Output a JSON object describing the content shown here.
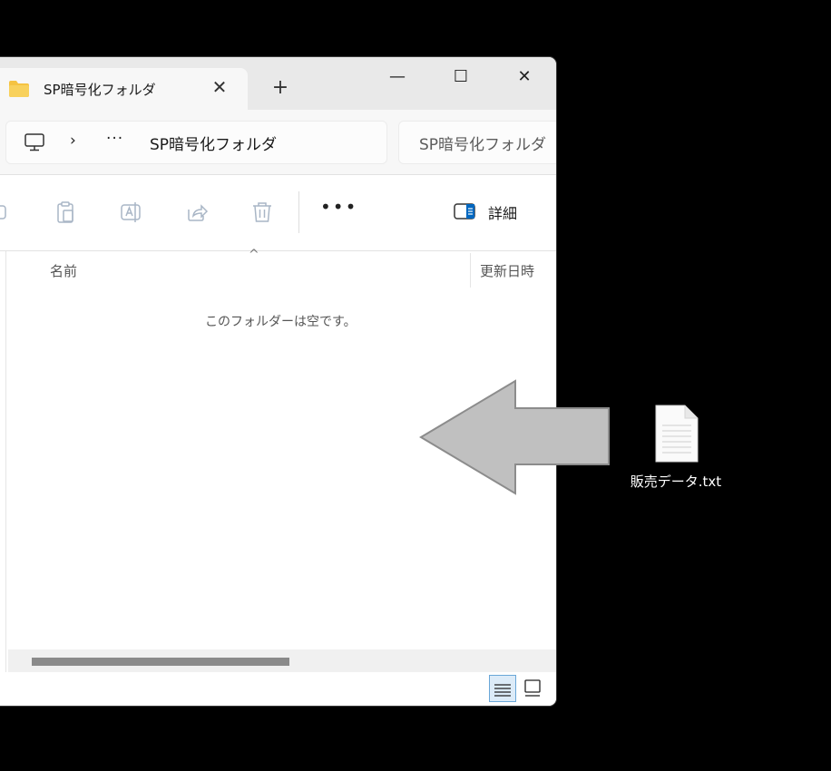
{
  "window": {
    "tab": {
      "label": "SP暗号化フォルダ"
    },
    "buttons": {
      "new_tab": "+",
      "minimize": "—",
      "maximize": "☐",
      "close": "✕",
      "tab_close": "✕"
    },
    "address": {
      "chevron": "›",
      "overflow": "···",
      "crumb": "SP暗号化フォルダ"
    },
    "search": {
      "placeholder": "SP暗号化フォルダ"
    },
    "commands": {
      "icons": [
        "copy-icon",
        "paste-icon",
        "rename-icon",
        "share-icon",
        "delete-icon"
      ],
      "more": "•••",
      "details_label": "詳細"
    },
    "columns": {
      "sort_indicator": "^",
      "name": "名前",
      "date": "更新日時"
    },
    "empty_message": "このフォルダーは空です。",
    "view_modes": {
      "active": "details"
    }
  },
  "desktop": {
    "file": {
      "name": "販売データ.txt"
    },
    "overlay": {
      "direction": "left"
    }
  },
  "colors": {
    "background": "#000000",
    "window_bg": "#ffffff",
    "titlebar_bg": "#e9e9e9",
    "accent": "#0067c0",
    "folder_yellow": "#f5c342",
    "arrow_fill": "#c0c0c0"
  }
}
